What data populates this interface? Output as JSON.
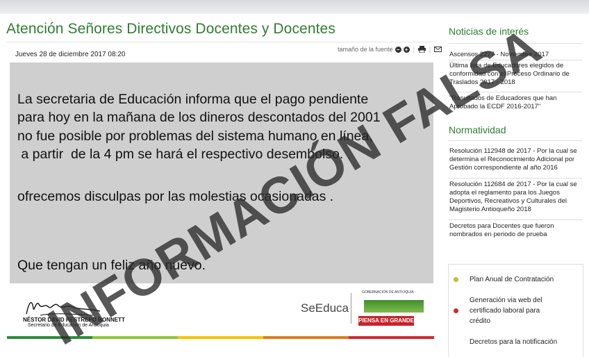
{
  "article": {
    "title": "Atención Señores Directivos Docentes y Docentes",
    "date": "Jueves 28 de diciembre 2017  08:20",
    "tools_label": "tamaño de la fuente"
  },
  "notice": {
    "lines": [
      "La secretaria de Educación informa que el pago pendiente",
      "para hoy en la mañana de los dineros descontados del 2001",
      "no fue posible por problemas del sistema humano en línea,",
      " a partir  de la 4 pm se hará el respectivo desembolso.",
      "ofrecemos disculpas por las molestias ocasionadas .",
      "Que tengan un feliz año nuevo."
    ]
  },
  "signature": {
    "name": "NÉSTOR DAVID RESTREPO BONNETT",
    "role": "Secretario de Educación de Antioquia"
  },
  "logos": {
    "seeduca": "SeEduca",
    "gobernacion": "GOBERNACIÓN DE ANTIOQUIA",
    "piensa": "PIENSA EN GRANDE"
  },
  "sidebar": {
    "news_heading": "Noticias de interés",
    "news": [
      "Ascensos 2277 - Noviembre 2017",
      "Última lista de Educadores elegidos de conformidad con el Proceso Ordinario de Traslados 2017 - 2018",
      "\"Resultados de Educadores que han Aprobado la ECDF 2016-2017\""
    ],
    "norm_heading": "Normatividad",
    "norms": [
      "Resolución 112948 de 2017 - Por la cual se determina el Reconocimiento Adicional por Gestión correspondiente al año 2016",
      "Resolución 112684 de 2017 - Por la cual se adopta el reglamento para los Juegos Deportivos, Recreativos y Culturales del Magisterio Antioqueño 2018",
      "Decretos para Docentes que fueron nombrados en periodo de prueba"
    ],
    "links": [
      "Plan Anual de Contratación",
      "Generación via web del certificado laboral para crédito",
      "Decretos para la notificación"
    ]
  },
  "watermark": "INFORMACIÓN FALSA",
  "colors": {
    "title_green": "#2f7d32",
    "notice_bg": "#cfcfcf",
    "bar": [
      "#2e8b3a",
      "#8dc63f",
      "#f2c400",
      "#e07b1f",
      "#d6262e"
    ]
  }
}
